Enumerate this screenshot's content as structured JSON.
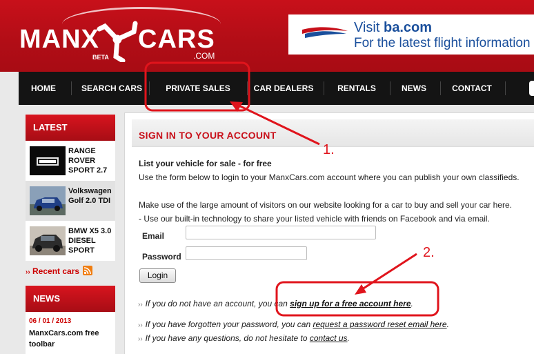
{
  "logo": {
    "left": "MANX",
    "right": "CARS",
    "suffix": ".COM",
    "badge": "BETA"
  },
  "ad": {
    "prefix": "Visit ",
    "domain": "ba.com",
    "tagline": "For the latest flight information"
  },
  "nav": [
    "HOME",
    "SEARCH CARS",
    "PRIVATE SALES",
    "CAR DEALERS",
    "RENTALS",
    "NEWS",
    "CONTACT"
  ],
  "sidebar": {
    "latest_heading": "LATEST",
    "cars": [
      {
        "name": "RANGE ROVER SPORT 2.7"
      },
      {
        "name": "Volkswagen Golf 2.0 TDI"
      },
      {
        "name": "BMW X5 3.0 DIESEL SPORT"
      }
    ],
    "recent_link": "Recent cars",
    "news_heading": "NEWS",
    "news": [
      {
        "date": "06 / 01 / 2013",
        "title": "ManxCars.com free toolbar"
      }
    ]
  },
  "main": {
    "title": "SIGN IN TO YOUR ACCOUNT",
    "subtitle": "List your vehicle for sale - for free",
    "intro": "Use the form below to login to your ManxCars.com account where you can publish your own classifieds.",
    "para1": "Make use of the large amount of visitors on our website looking for a car to buy and sell your car here.",
    "para2": "- Use our built-in technology to share your listed vehicle with friends on Facebook and via email.",
    "email_label": "Email",
    "password_label": "Password",
    "email_value": "",
    "password_value": "",
    "login_button": "Login",
    "signup_prefix": "If you do not have an account, you can ",
    "signup_link": "sign up for a free account here",
    "signup_suffix": ".",
    "reset_prefix": "If you have forgotten your password, you can ",
    "reset_link": "request a password reset email here",
    "reset_suffix": ".",
    "contact_prefix": "If you have any questions, do not hesitate to ",
    "contact_link": "contact us",
    "contact_suffix": "."
  },
  "annotations": {
    "first": "1.",
    "second": "2.",
    "color": "#e0141c"
  }
}
